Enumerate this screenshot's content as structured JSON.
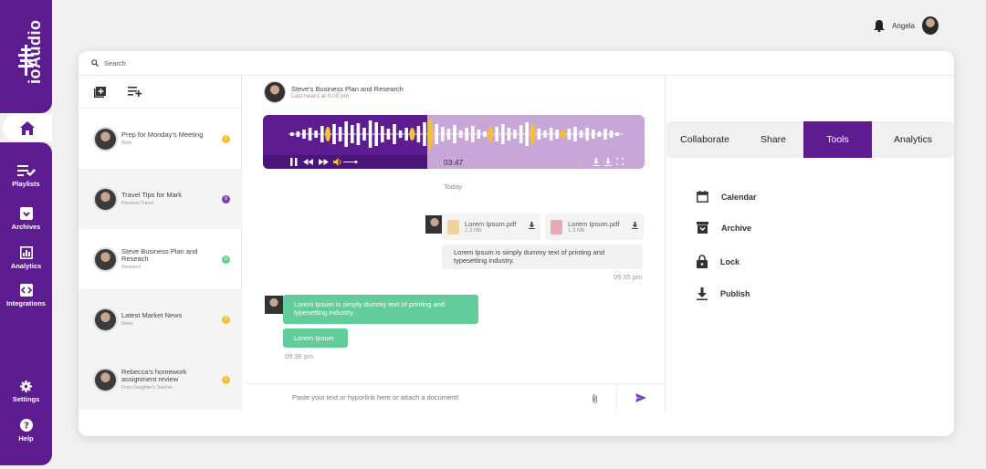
{
  "app": {
    "name": "ioAudio"
  },
  "nav": {
    "playlists": "Playlists",
    "archives": "Archives",
    "analytics": "Analytics",
    "integrations": "Integrations",
    "settings": "Settings",
    "help": "Help"
  },
  "user": {
    "name": "Angela"
  },
  "search": {
    "placeholder": "Search"
  },
  "conversations": [
    {
      "title": "Prep for Monday's Meeting",
      "sub": "Work",
      "badge": "2",
      "badge_color": "#f2c230"
    },
    {
      "title": "Travel Tips for Mark",
      "sub": "Personal Travel",
      "badge": "8",
      "badge_color": "#7a3bbf"
    },
    {
      "title": "Steve Business Plan and Reseach",
      "sub": "Research",
      "badge": "12",
      "badge_color": "#5fcf9a"
    },
    {
      "title": "Latest Market News",
      "sub": "News",
      "badge": "3",
      "badge_color": "#f2c230"
    },
    {
      "title": "Rebecca's homework assignment review",
      "sub": "From Daughter's Teacher",
      "badge": "2",
      "badge_color": "#f2c230"
    }
  ],
  "chat": {
    "title": "Steve's Business Plan and Research",
    "subtitle": "Last heard at 9:00 pm",
    "player_time": "03:47",
    "player_progress": 0.43,
    "date_label": "Today",
    "files": [
      {
        "name": "Lorem Ipsum.pdf",
        "size": "1.3 Mb",
        "color": "#f0d39a"
      },
      {
        "name": "Lorem Ipsum.pdf",
        "size": "1.3 Mb",
        "color": "#e8a9b7"
      }
    ],
    "msg_out": "Lorem Ipsum is simply dummy text of printing and typesetting industry.",
    "time_out": "09.35 pm",
    "msg_in_1": "Lorem Ipsum is simply dummy text of printing and typesetting industry.",
    "msg_in_2": "Lorem Ipsum",
    "time_in": "09.36 pm",
    "compose_placeholder": "Paste your text or hyporlink here or attach a document!"
  },
  "tabs": [
    "Collaborate",
    "Share",
    "Tools",
    "Analytics"
  ],
  "active_tab": "Tools",
  "tools": [
    "Calendar",
    "Archive",
    "Lock",
    "Publish"
  ],
  "colors": {
    "brand": "#5e1c91",
    "accent_green": "#62cc9a",
    "accent_yellow": "#f2c230"
  }
}
